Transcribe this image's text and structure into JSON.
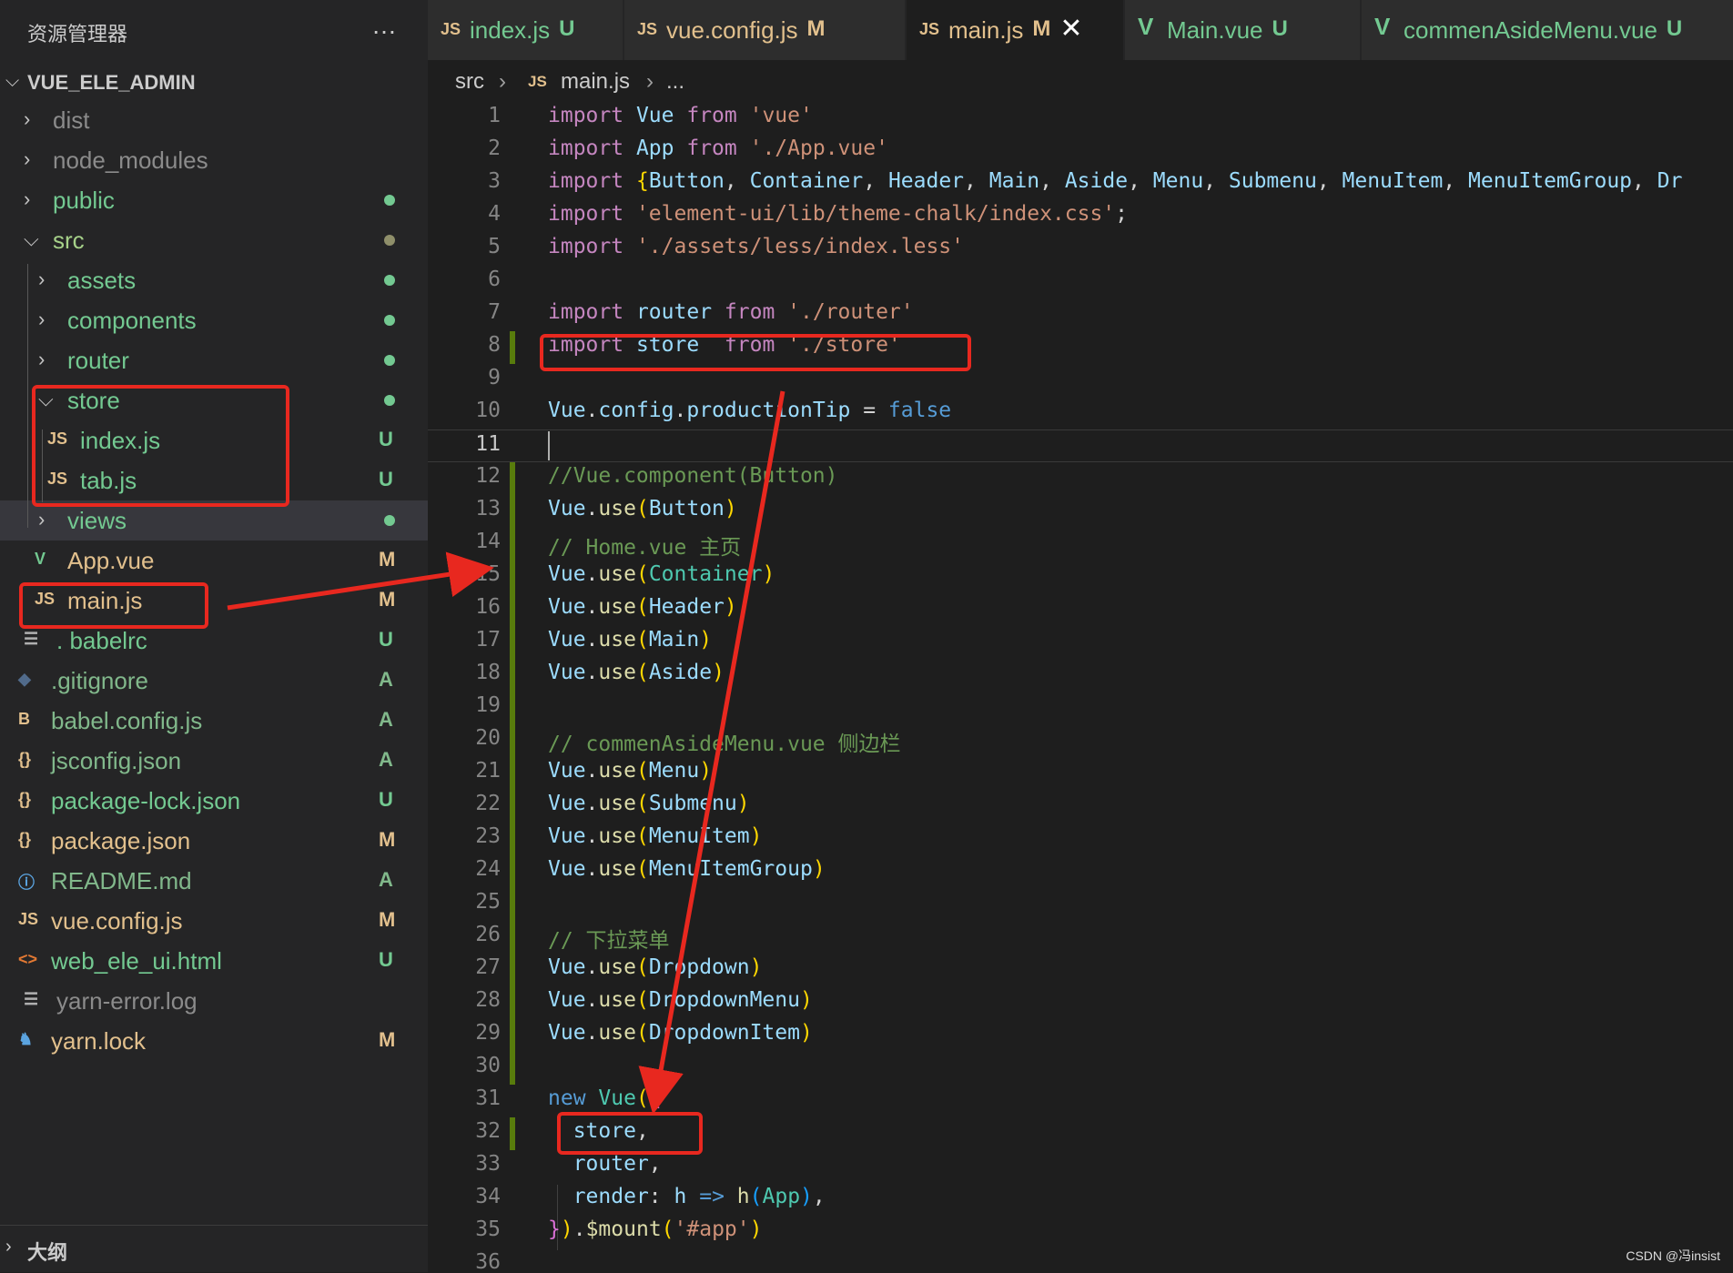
{
  "sidebar": {
    "title": "资源管理器",
    "more_icon": "…",
    "root_folder": "VUE_ELE_ADMIN",
    "items": [
      {
        "label": "dist",
        "kind": "folder",
        "expanded": false,
        "color": "#8b8b8b",
        "badge": "",
        "dot": false
      },
      {
        "label": "node_modules",
        "kind": "folder",
        "expanded": false,
        "color": "#8b8b8b",
        "badge": "",
        "dot": false
      },
      {
        "label": "public",
        "kind": "folder",
        "expanded": false,
        "color": "#73c991",
        "badge": "",
        "dot": true,
        "dot_color": "#73c991"
      },
      {
        "label": "src",
        "kind": "folder",
        "expanded": true,
        "color": "#a6d189",
        "badge": "",
        "dot": true,
        "dot_color": "#8f8f6a"
      },
      {
        "label": "assets",
        "kind": "folder",
        "expanded": false,
        "color": "#73c991",
        "badge": "",
        "dot": true,
        "dot_color": "#73c991"
      },
      {
        "label": "components",
        "kind": "folder",
        "expanded": false,
        "color": "#73c991",
        "badge": "",
        "dot": true,
        "dot_color": "#73c991"
      },
      {
        "label": "router",
        "kind": "folder",
        "expanded": false,
        "color": "#73c991",
        "badge": "",
        "dot": true,
        "dot_color": "#73c991"
      },
      {
        "label": "store",
        "kind": "folder",
        "expanded": true,
        "color": "#73c991",
        "badge": "",
        "dot": true,
        "dot_color": "#73c991"
      },
      {
        "label": "index.js",
        "kind": "js",
        "color": "#73c991",
        "badge": "U",
        "badge_color": "#73c991"
      },
      {
        "label": "tab.js",
        "kind": "js",
        "color": "#73c991",
        "badge": "U",
        "badge_color": "#73c991"
      },
      {
        "label": "views",
        "kind": "folder",
        "expanded": false,
        "color": "#73c991",
        "badge": "",
        "dot": true,
        "dot_color": "#73c991"
      },
      {
        "label": "App.vue",
        "kind": "vue",
        "color": "#e2c08d",
        "badge": "M",
        "badge_color": "#e2c08d"
      },
      {
        "label": "main.js",
        "kind": "js",
        "color": "#e2c08d",
        "badge": "M",
        "badge_color": "#e2c08d"
      },
      {
        "label": ". babelrc",
        "kind": "lines",
        "color": "#73c991",
        "badge": "U",
        "badge_color": "#73c991"
      },
      {
        "label": ".gitignore",
        "kind": "git",
        "color": "#81b88b",
        "badge": "A",
        "badge_color": "#81b88b"
      },
      {
        "label": "babel.config.js",
        "kind": "babel",
        "color": "#81b88b",
        "badge": "A",
        "badge_color": "#81b88b"
      },
      {
        "label": "jsconfig.json",
        "kind": "json",
        "color": "#81b88b",
        "badge": "A",
        "badge_color": "#81b88b"
      },
      {
        "label": "package-lock.json",
        "kind": "json",
        "color": "#73c991",
        "badge": "U",
        "badge_color": "#73c991"
      },
      {
        "label": "package.json",
        "kind": "json",
        "color": "#e2c08d",
        "badge": "M",
        "badge_color": "#e2c08d"
      },
      {
        "label": "README.md",
        "kind": "info",
        "color": "#81b88b",
        "badge": "A",
        "badge_color": "#81b88b"
      },
      {
        "label": "vue.config.js",
        "kind": "js",
        "color": "#e2c08d",
        "badge": "M",
        "badge_color": "#e2c08d"
      },
      {
        "label": "web_ele_ui.html",
        "kind": "html",
        "color": "#73c991",
        "badge": "U",
        "badge_color": "#73c991"
      },
      {
        "label": "yarn-error.log",
        "kind": "lines",
        "color": "#8b8b8b",
        "badge": "",
        "dot": false
      },
      {
        "label": "yarn.lock",
        "kind": "yarn",
        "color": "#e2c08d",
        "badge": "M",
        "badge_color": "#e2c08d"
      }
    ],
    "outline_label": "大纲"
  },
  "tabs": [
    {
      "label": "index.js",
      "icon": "JS",
      "badge": "U",
      "color": "#73c991",
      "active": false
    },
    {
      "label": "vue.config.js",
      "icon": "JS",
      "badge": "M",
      "color": "#e2c08d",
      "active": false
    },
    {
      "label": "main.js",
      "icon": "JS",
      "badge": "M",
      "color": "#e2c08d",
      "active": true,
      "close": "✕"
    },
    {
      "label": "Main.vue",
      "icon": "V",
      "badge": "U",
      "color": "#73c991",
      "active": false
    },
    {
      "label": "commenAsideMenu.vue",
      "icon": "V",
      "badge": "U",
      "color": "#73c991",
      "active": false
    }
  ],
  "breadcrumb": {
    "folder": "src",
    "file_icon": "JS",
    "file": "main.js",
    "more": "..."
  },
  "editor": {
    "current_line": 11,
    "lines": [
      {
        "n": "1",
        "gutter": "",
        "toks": [
          [
            "kw",
            "import"
          ],
          [
            "pun",
            " "
          ],
          [
            "id",
            "Vue"
          ],
          [
            "pun",
            " "
          ],
          [
            "kw",
            "from"
          ],
          [
            "pun",
            " "
          ],
          [
            "str",
            "'vue'"
          ]
        ]
      },
      {
        "n": "2",
        "gutter": "",
        "toks": [
          [
            "kw",
            "import"
          ],
          [
            "pun",
            " "
          ],
          [
            "id",
            "App"
          ],
          [
            "pun",
            " "
          ],
          [
            "kw",
            "from"
          ],
          [
            "pun",
            " "
          ],
          [
            "str",
            "'./App.vue'"
          ]
        ]
      },
      {
        "n": "3",
        "gutter": "",
        "toks": [
          [
            "kw",
            "import"
          ],
          [
            "pun",
            " "
          ],
          [
            "br",
            "{"
          ],
          [
            "id",
            "Button"
          ],
          [
            "pun",
            ", "
          ],
          [
            "id",
            "Container"
          ],
          [
            "pun",
            ", "
          ],
          [
            "id",
            "Header"
          ],
          [
            "pun",
            ", "
          ],
          [
            "id",
            "Main"
          ],
          [
            "pun",
            ", "
          ],
          [
            "id",
            "Aside"
          ],
          [
            "pun",
            ", "
          ],
          [
            "id",
            "Menu"
          ],
          [
            "pun",
            ", "
          ],
          [
            "id",
            "Submenu"
          ],
          [
            "pun",
            ", "
          ],
          [
            "id",
            "MenuItem"
          ],
          [
            "pun",
            ", "
          ],
          [
            "id",
            "MenuItemGroup"
          ],
          [
            "pun",
            ", "
          ],
          [
            "id",
            "Dr"
          ]
        ]
      },
      {
        "n": "4",
        "gutter": "",
        "toks": [
          [
            "kw",
            "import"
          ],
          [
            "pun",
            " "
          ],
          [
            "str",
            "'element-ui/lib/theme-chalk/index.css'"
          ],
          [
            "pun",
            ";"
          ]
        ]
      },
      {
        "n": "5",
        "gutter": "",
        "toks": [
          [
            "kw",
            "import"
          ],
          [
            "pun",
            " "
          ],
          [
            "str",
            "'./assets/less/index.less'"
          ]
        ]
      },
      {
        "n": "6",
        "gutter": "",
        "toks": []
      },
      {
        "n": "7",
        "gutter": "",
        "toks": [
          [
            "kw",
            "import"
          ],
          [
            "pun",
            " "
          ],
          [
            "id",
            "router"
          ],
          [
            "pun",
            " "
          ],
          [
            "kw",
            "from"
          ],
          [
            "pun",
            " "
          ],
          [
            "str",
            "'./router'"
          ]
        ]
      },
      {
        "n": "8",
        "gutter": "add",
        "toks": [
          [
            "kw",
            "import"
          ],
          [
            "pun",
            " "
          ],
          [
            "id",
            "store"
          ],
          [
            "pun",
            "  "
          ],
          [
            "kw",
            "from"
          ],
          [
            "pun",
            " "
          ],
          [
            "str",
            "'./store'"
          ]
        ]
      },
      {
        "n": "9",
        "gutter": "",
        "toks": []
      },
      {
        "n": "10",
        "gutter": "",
        "toks": [
          [
            "id",
            "Vue"
          ],
          [
            "pun",
            "."
          ],
          [
            "id",
            "config"
          ],
          [
            "pun",
            "."
          ],
          [
            "id",
            "productionTip"
          ],
          [
            "pun",
            " = "
          ],
          [
            "blue",
            "false"
          ]
        ]
      },
      {
        "n": "11",
        "gutter": "",
        "toks": []
      },
      {
        "n": "12",
        "gutter": "add",
        "toks": [
          [
            "cmt",
            "//Vue.component(Button)"
          ]
        ]
      },
      {
        "n": "13",
        "gutter": "add",
        "toks": [
          [
            "id",
            "Vue"
          ],
          [
            "pun",
            "."
          ],
          [
            "fn",
            "use"
          ],
          [
            "br",
            "("
          ],
          [
            "id",
            "Button"
          ],
          [
            "br",
            ")"
          ]
        ]
      },
      {
        "n": "14",
        "gutter": "add",
        "toks": [
          [
            "cmt",
            "// Home.vue 主页"
          ]
        ]
      },
      {
        "n": "15",
        "gutter": "add",
        "toks": [
          [
            "id",
            "Vue"
          ],
          [
            "pun",
            "."
          ],
          [
            "fn",
            "use"
          ],
          [
            "br",
            "("
          ],
          [
            "type",
            "Container"
          ],
          [
            "br",
            ")"
          ]
        ]
      },
      {
        "n": "16",
        "gutter": "add",
        "toks": [
          [
            "id",
            "Vue"
          ],
          [
            "pun",
            "."
          ],
          [
            "fn",
            "use"
          ],
          [
            "br",
            "("
          ],
          [
            "id",
            "Header"
          ],
          [
            "br",
            ")"
          ]
        ]
      },
      {
        "n": "17",
        "gutter": "add",
        "toks": [
          [
            "id",
            "Vue"
          ],
          [
            "pun",
            "."
          ],
          [
            "fn",
            "use"
          ],
          [
            "br",
            "("
          ],
          [
            "id",
            "Main"
          ],
          [
            "br",
            ")"
          ]
        ]
      },
      {
        "n": "18",
        "gutter": "add",
        "toks": [
          [
            "id",
            "Vue"
          ],
          [
            "pun",
            "."
          ],
          [
            "fn",
            "use"
          ],
          [
            "br",
            "("
          ],
          [
            "id",
            "Aside"
          ],
          [
            "br",
            ")"
          ]
        ]
      },
      {
        "n": "19",
        "gutter": "add",
        "toks": []
      },
      {
        "n": "20",
        "gutter": "add",
        "toks": [
          [
            "cmt",
            "// commenAsideMenu.vue 侧边栏"
          ]
        ]
      },
      {
        "n": "21",
        "gutter": "add",
        "toks": [
          [
            "id",
            "Vue"
          ],
          [
            "pun",
            "."
          ],
          [
            "fn",
            "use"
          ],
          [
            "br",
            "("
          ],
          [
            "id",
            "Menu"
          ],
          [
            "br",
            ")"
          ]
        ]
      },
      {
        "n": "22",
        "gutter": "add",
        "toks": [
          [
            "id",
            "Vue"
          ],
          [
            "pun",
            "."
          ],
          [
            "fn",
            "use"
          ],
          [
            "br",
            "("
          ],
          [
            "id",
            "Submenu"
          ],
          [
            "br",
            ")"
          ]
        ]
      },
      {
        "n": "23",
        "gutter": "add",
        "toks": [
          [
            "id",
            "Vue"
          ],
          [
            "pun",
            "."
          ],
          [
            "fn",
            "use"
          ],
          [
            "br",
            "("
          ],
          [
            "id",
            "MenuItem"
          ],
          [
            "br",
            ")"
          ]
        ]
      },
      {
        "n": "24",
        "gutter": "add",
        "toks": [
          [
            "id",
            "Vue"
          ],
          [
            "pun",
            "."
          ],
          [
            "fn",
            "use"
          ],
          [
            "br",
            "("
          ],
          [
            "id",
            "MenuItemGroup"
          ],
          [
            "br",
            ")"
          ]
        ]
      },
      {
        "n": "25",
        "gutter": "add",
        "toks": []
      },
      {
        "n": "26",
        "gutter": "add",
        "toks": [
          [
            "cmt",
            "// 下拉菜单"
          ]
        ]
      },
      {
        "n": "27",
        "gutter": "add",
        "toks": [
          [
            "id",
            "Vue"
          ],
          [
            "pun",
            "."
          ],
          [
            "fn",
            "use"
          ],
          [
            "br",
            "("
          ],
          [
            "id",
            "Dropdown"
          ],
          [
            "br",
            ")"
          ]
        ]
      },
      {
        "n": "28",
        "gutter": "add",
        "toks": [
          [
            "id",
            "Vue"
          ],
          [
            "pun",
            "."
          ],
          [
            "fn",
            "use"
          ],
          [
            "br",
            "("
          ],
          [
            "id",
            "DropdownMenu"
          ],
          [
            "br",
            ")"
          ]
        ]
      },
      {
        "n": "29",
        "gutter": "add",
        "toks": [
          [
            "id",
            "Vue"
          ],
          [
            "pun",
            "."
          ],
          [
            "fn",
            "use"
          ],
          [
            "br",
            "("
          ],
          [
            "id",
            "DropdownItem"
          ],
          [
            "br",
            ")"
          ]
        ]
      },
      {
        "n": "30",
        "gutter": "add",
        "toks": []
      },
      {
        "n": "31",
        "gutter": "",
        "toks": [
          [
            "blue",
            "new"
          ],
          [
            "pun",
            " "
          ],
          [
            "type",
            "Vue"
          ],
          [
            "br",
            "("
          ],
          [
            "br2",
            "{"
          ]
        ]
      },
      {
        "n": "32",
        "gutter": "add",
        "toks": [
          [
            "pun",
            "  "
          ],
          [
            "id",
            "store"
          ],
          [
            "pun",
            ","
          ]
        ]
      },
      {
        "n": "33",
        "gutter": "",
        "toks": [
          [
            "pun",
            "  "
          ],
          [
            "id",
            "router"
          ],
          [
            "pun",
            ","
          ]
        ]
      },
      {
        "n": "34",
        "gutter": "",
        "toks": [
          [
            "pun",
            "  "
          ],
          [
            "id",
            "render"
          ],
          [
            "pun",
            ": "
          ],
          [
            "id",
            "h"
          ],
          [
            "pun",
            " "
          ],
          [
            "blue",
            "=>"
          ],
          [
            "pun",
            " "
          ],
          [
            "fn",
            "h"
          ],
          [
            "br3",
            "("
          ],
          [
            "type",
            "App"
          ],
          [
            "br3",
            ")"
          ],
          [
            "pun",
            ","
          ]
        ]
      },
      {
        "n": "35",
        "gutter": "",
        "toks": [
          [
            "br2",
            "}"
          ],
          [
            "br",
            ")"
          ],
          [
            "pun",
            "."
          ],
          [
            "fn",
            "$mount"
          ],
          [
            "br",
            "("
          ],
          [
            "str",
            "'#app'"
          ],
          [
            "br",
            ")"
          ]
        ]
      },
      {
        "n": "36",
        "gutter": "",
        "toks": []
      }
    ]
  },
  "colors": {
    "accent_red": "#e8281f",
    "git_added": "#587c0c",
    "git_untracked": "#73c991",
    "git_modified": "#e2c08d"
  },
  "watermark": "CSDN @冯insist"
}
